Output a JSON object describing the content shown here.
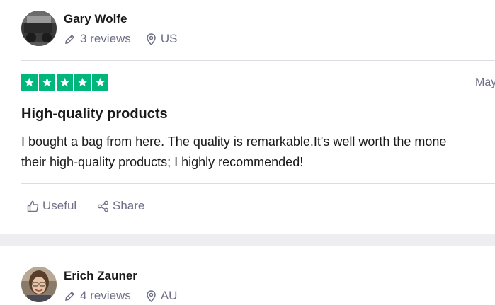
{
  "reviews": [
    {
      "reviewer": {
        "name": "Gary Wolfe",
        "reviews_count": "3 reviews",
        "country": "US"
      },
      "rating": 5,
      "date": "May",
      "title": "High-quality products",
      "body_lines": [
        "I bought a bag from here. The quality is remarkable.It's well worth the mone",
        "their high-quality products; I highly recommended!"
      ],
      "actions": {
        "useful": "Useful",
        "share": "Share"
      }
    },
    {
      "reviewer": {
        "name": "Erich Zauner",
        "reviews_count": "4 reviews",
        "country": "AU"
      }
    }
  ],
  "colors": {
    "star_green": "#00b67a",
    "muted_text": "#6f6f87",
    "divider": "#dcdce6",
    "page_gap": "#eeeef0"
  },
  "icons": [
    "pencil-icon",
    "location-pin-icon",
    "star-icon",
    "thumbs-up-icon",
    "share-icon"
  ]
}
